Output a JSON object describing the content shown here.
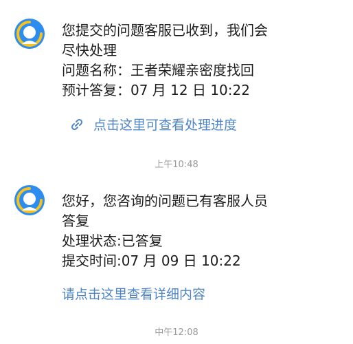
{
  "messages": [
    {
      "avatar_icon": "service-robot-icon",
      "lines": [
        "您提交的问题客服已收到，我们会",
        "尽快处理",
        "问题名称：王者荣耀亲密度找回",
        "预计答复：07 月 12 日 10:22"
      ],
      "link": {
        "icon": "link-icon",
        "label": "点击这里可查看处理进度"
      },
      "timestamp": "上午10:48"
    },
    {
      "avatar_icon": "service-robot-icon",
      "lines": [
        "您好，您咨询的问题已有客服人员",
        "答复",
        "处理状态:已答复",
        "提交时间:07 月 09 日 10:22"
      ],
      "link": {
        "label": "请点击这里查看详细内容"
      },
      "timestamp": "中午12:08"
    }
  ],
  "colors": {
    "link": "#4f86c6",
    "avatar_bg": "#2d8cf0",
    "avatar_ring": "#f7c21b",
    "timestamp": "#9a9a9a"
  }
}
